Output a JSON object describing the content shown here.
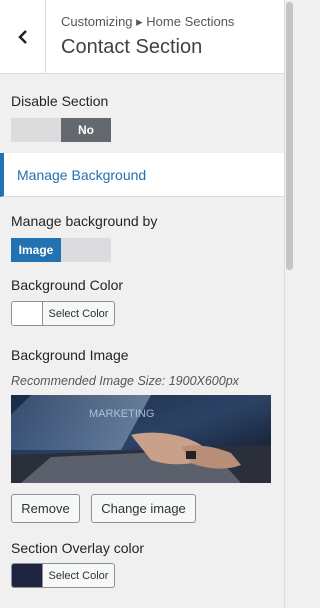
{
  "header": {
    "breadcrumb": "Customizing ▸ Home Sections",
    "title": "Contact Section",
    "back_icon": "chevron-left-icon"
  },
  "disable_section": {
    "label": "Disable Section",
    "toggle_value": "No",
    "toggle_state": "off"
  },
  "manage_background_link": "Manage Background",
  "manage_background_by": {
    "label": "Manage background by",
    "selected": "Image"
  },
  "background_color": {
    "label": "Background Color",
    "button_label": "Select Color",
    "swatch": "#ffffff"
  },
  "background_image": {
    "label": "Background Image",
    "hint": "Recommended Image Size: 1900X600px",
    "remove_label": "Remove",
    "change_label": "Change image"
  },
  "overlay_color": {
    "label": "Section Overlay color",
    "button_label": "Select Color",
    "swatch": "#1f2440"
  },
  "colors": {
    "accent": "#2271b1",
    "toggle_dark": "#646970"
  }
}
